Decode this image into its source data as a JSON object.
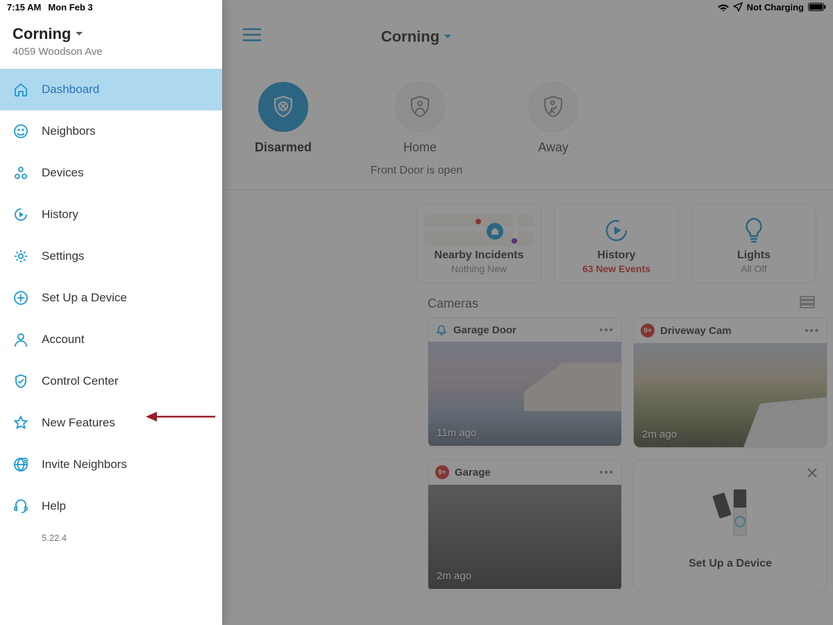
{
  "status": {
    "time": "7:15 AM",
    "date": "Mon Feb 3",
    "charge": "Not Charging"
  },
  "sidebar": {
    "location": "Corning",
    "address": "4059 Woodson Ave",
    "version": "5.22.4",
    "items": [
      {
        "label": "Dashboard"
      },
      {
        "label": "Neighbors"
      },
      {
        "label": "Devices"
      },
      {
        "label": "History"
      },
      {
        "label": "Settings"
      },
      {
        "label": "Set Up a Device"
      },
      {
        "label": "Account"
      },
      {
        "label": "Control Center"
      },
      {
        "label": "New Features"
      },
      {
        "label": "Invite Neighbors"
      },
      {
        "label": "Help"
      }
    ]
  },
  "main": {
    "title": "Corning",
    "modes": {
      "disarmed": "Disarmed",
      "home": "Home",
      "away": "Away"
    },
    "alert": "Front Door is open",
    "tiles": {
      "incidents": {
        "title": "Nearby Incidents",
        "sub": "Nothing New"
      },
      "history": {
        "title": "History",
        "sub": "63 New Events"
      },
      "lights": {
        "title": "Lights",
        "sub": "All Off"
      }
    },
    "cameras_label": "Cameras",
    "cameras": [
      {
        "name": "Garage Door",
        "time": "11m ago",
        "badge": ""
      },
      {
        "name": "Driveway Cam",
        "time": "2m ago",
        "badge": "9+"
      },
      {
        "name": "Garage",
        "time": "2m ago",
        "badge": "9+"
      }
    ],
    "setup_label": "Set Up a Device"
  }
}
